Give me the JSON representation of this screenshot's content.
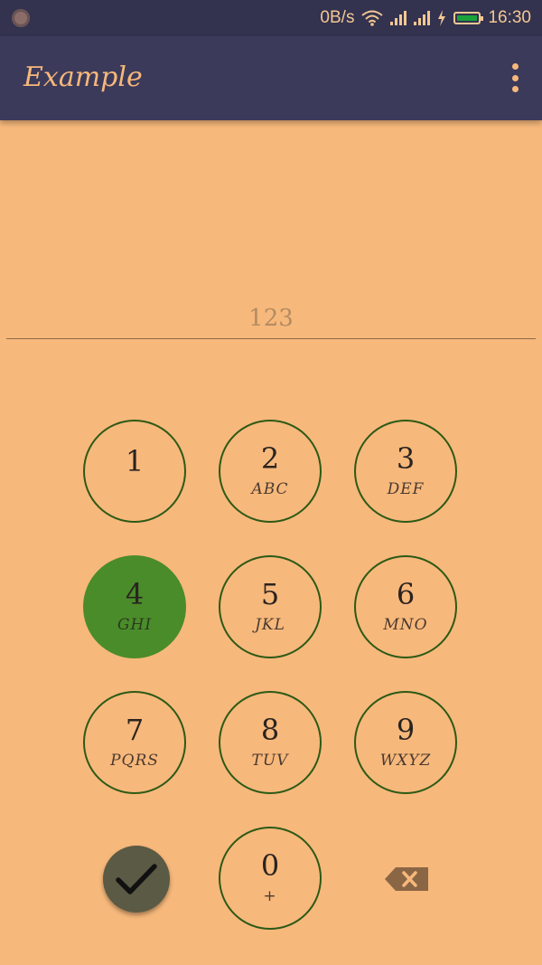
{
  "status_bar": {
    "net_speed": "0B/s",
    "time": "16:30",
    "icons": [
      "notification-icon",
      "wifi-icon",
      "signal-icon",
      "signal-icon",
      "charging-icon",
      "battery-icon"
    ],
    "battery_color": "#19a23a"
  },
  "app_bar": {
    "title": "Example",
    "overflow_icon": "more-vert-icon"
  },
  "input": {
    "placeholder": "123",
    "value": ""
  },
  "keypad": {
    "keys": [
      {
        "digit": "1",
        "letters": ""
      },
      {
        "digit": "2",
        "letters": "ABC"
      },
      {
        "digit": "3",
        "letters": "DEF"
      },
      {
        "digit": "4",
        "letters": "GHI",
        "pressed": true
      },
      {
        "digit": "5",
        "letters": "JKL"
      },
      {
        "digit": "6",
        "letters": "MNO"
      },
      {
        "digit": "7",
        "letters": "PQRS"
      },
      {
        "digit": "8",
        "letters": "TUV"
      },
      {
        "digit": "9",
        "letters": "WXYZ"
      },
      {
        "digit": "0",
        "letters": "+"
      }
    ],
    "confirm_icon": "check-icon",
    "backspace_icon": "backspace-icon"
  },
  "colors": {
    "background": "#f7b87b",
    "app_bar": "#3c3a5a",
    "status_bar": "#33324f",
    "key_border": "#2c5a16",
    "key_pressed": "#4a8c2a",
    "confirm_button": "#5b5a44",
    "backspace": "#8a6645"
  }
}
